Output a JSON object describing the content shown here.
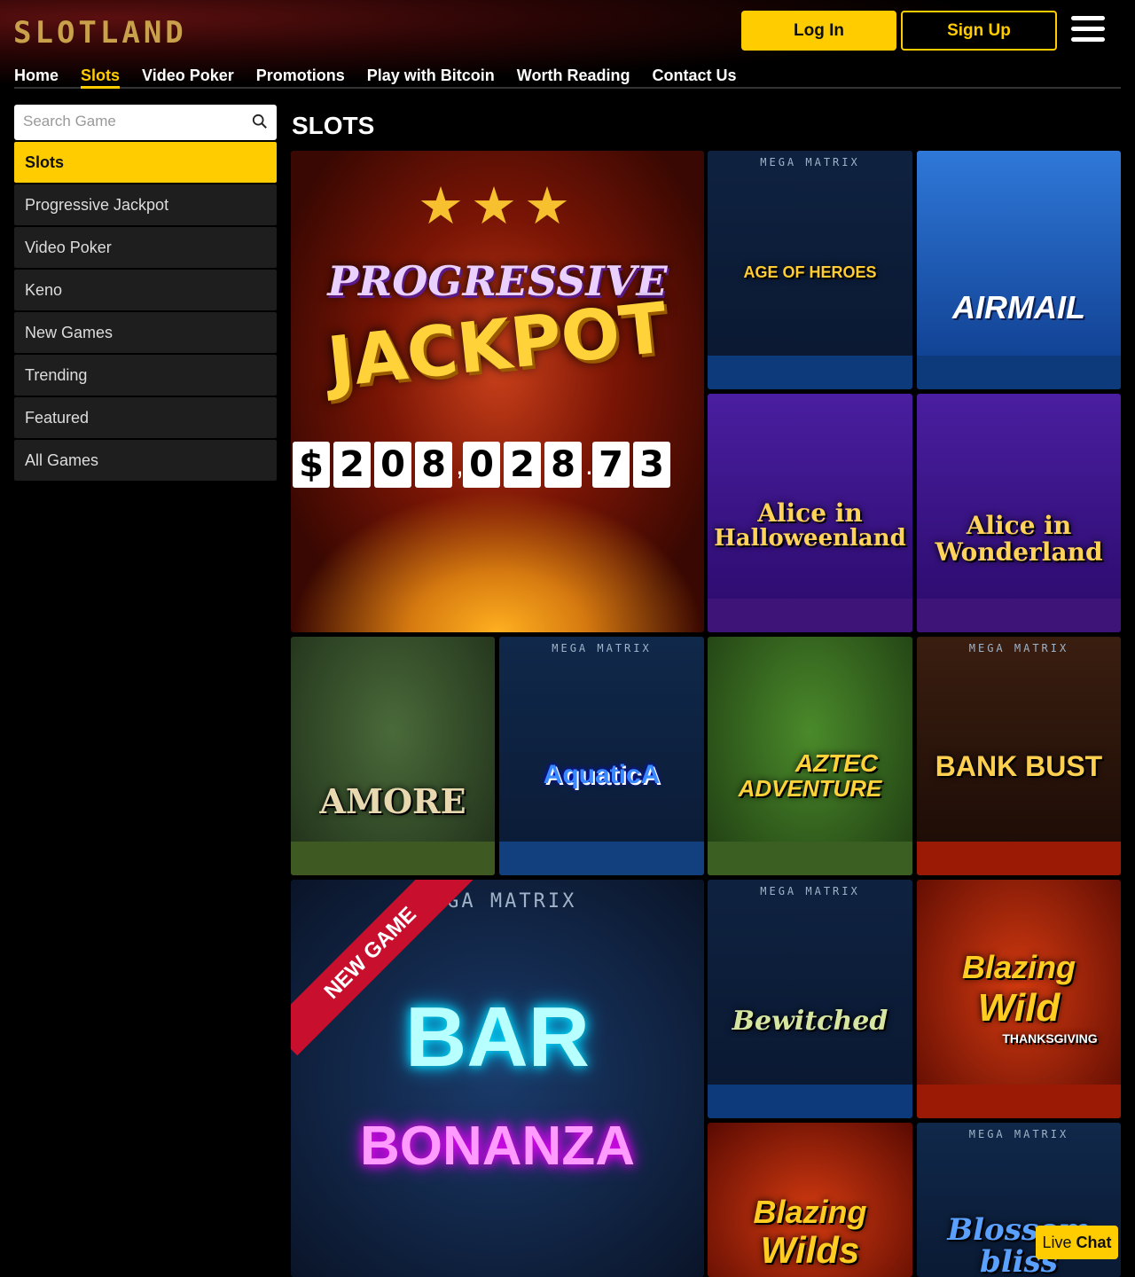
{
  "header": {
    "logo": "SLOTLAND",
    "login_label": "Log In",
    "signup_label": "Sign Up"
  },
  "nav": {
    "items": [
      "Home",
      "Slots",
      "Video Poker",
      "Promotions",
      "Play with Bitcoin",
      "Worth Reading",
      "Contact Us"
    ],
    "active": "Slots"
  },
  "search": {
    "placeholder": "Search Game"
  },
  "sidebar": {
    "items": [
      "Slots",
      "Progressive Jackpot",
      "Video Poker",
      "Keno",
      "New Games",
      "Trending",
      "Featured",
      "All Games"
    ],
    "active": "Slots"
  },
  "page_title": "SLOTS",
  "jackpot": {
    "line1": "PROGRESSIVE",
    "line2": "JACKPOT",
    "digits": [
      "$",
      "2",
      "0",
      "8",
      "0",
      "2",
      "8",
      "7",
      "3"
    ],
    "separators": [
      ",",
      "."
    ]
  },
  "games": {
    "age_of_heroes": {
      "badge": "MEGA MATRIX",
      "name": "AGE OF HEROES"
    },
    "airmail": {
      "name": "AIRMAIL"
    },
    "alice_halloween": {
      "name_l1": "Alice in",
      "name_l2": "Halloweenland"
    },
    "alice_wonderland": {
      "name_l1": "Alice in",
      "name_l2": "Wonderland"
    },
    "amore": {
      "name": "AMORE"
    },
    "aquatica": {
      "badge": "MEGA MATRIX",
      "name": "AquaticA"
    },
    "aztec": {
      "name_l1": "AZTEC",
      "name_l2": "ADVENTURE"
    },
    "bank_bust": {
      "badge": "MEGA MATRIX",
      "name": "BANK BUST"
    },
    "bar_bonanza": {
      "ribbon": "NEW GAME",
      "badge": "MEGA MATRIX",
      "name_l1": "BAR",
      "name_l2": "BONANZA"
    },
    "bewitched": {
      "badge": "MEGA MATRIX",
      "name": "Bewitched"
    },
    "blazing_wild": {
      "name_l1": "Blazing",
      "name_l2": "Wild",
      "name_l3": "THANKSGIVING"
    },
    "blazing_wilds": {
      "name_l1": "Blazing",
      "name_l2": "Wilds"
    },
    "blossom_bliss": {
      "badge": "MEGA MATRIX",
      "name": "Blossom bliss"
    }
  },
  "colors": {
    "accent": "#ffcc00",
    "bar_blue": "#0d3a7a",
    "bar_purple": "#3f1479",
    "bar_green": "#3e5a22",
    "bar_aqua_blue": "#123f7d",
    "bar_green2": "#3b5f22",
    "bar_red": "#9a1a06"
  },
  "live_chat": {
    "l1": "Live",
    "l2": "Chat"
  }
}
